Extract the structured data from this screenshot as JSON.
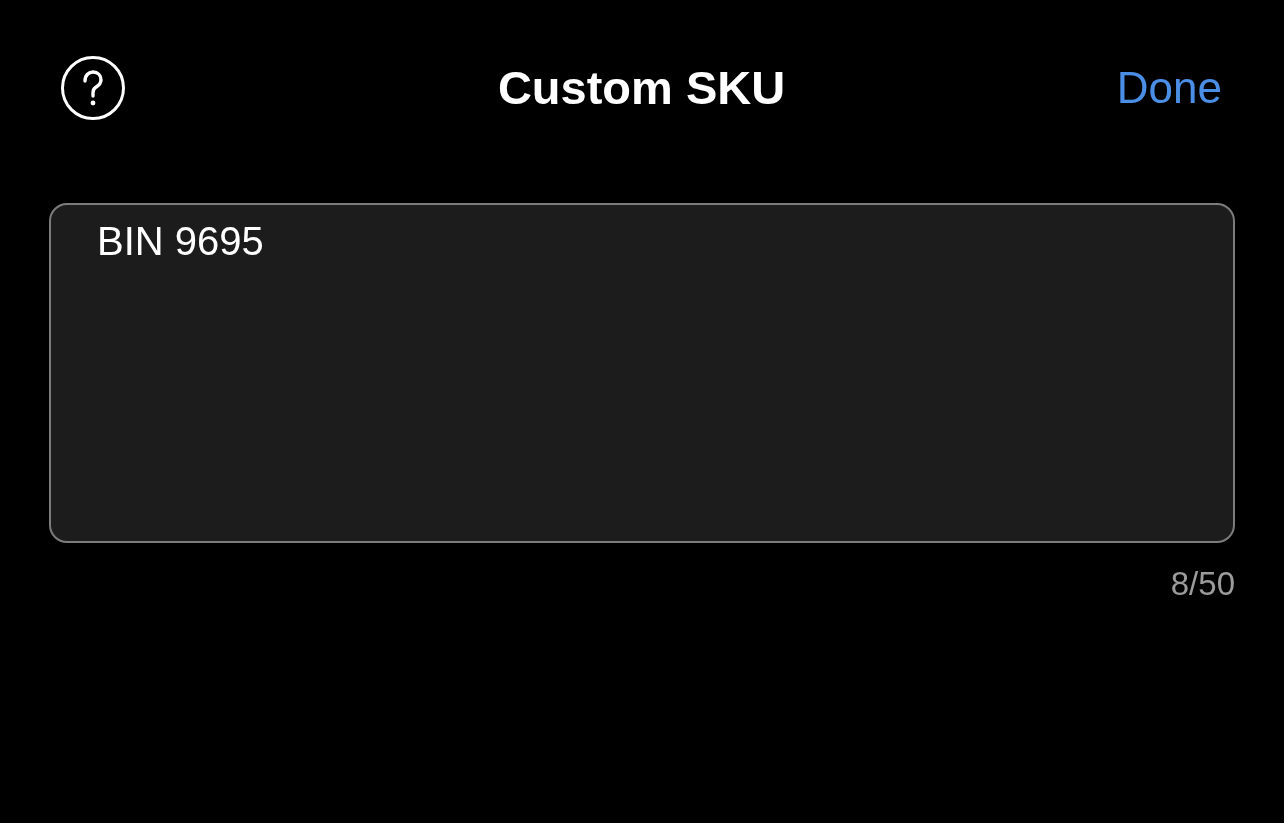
{
  "header": {
    "title": "Custom SKU",
    "done_button": "Done"
  },
  "sku_field": {
    "value": "BIN 9695",
    "counter": "8/50"
  }
}
